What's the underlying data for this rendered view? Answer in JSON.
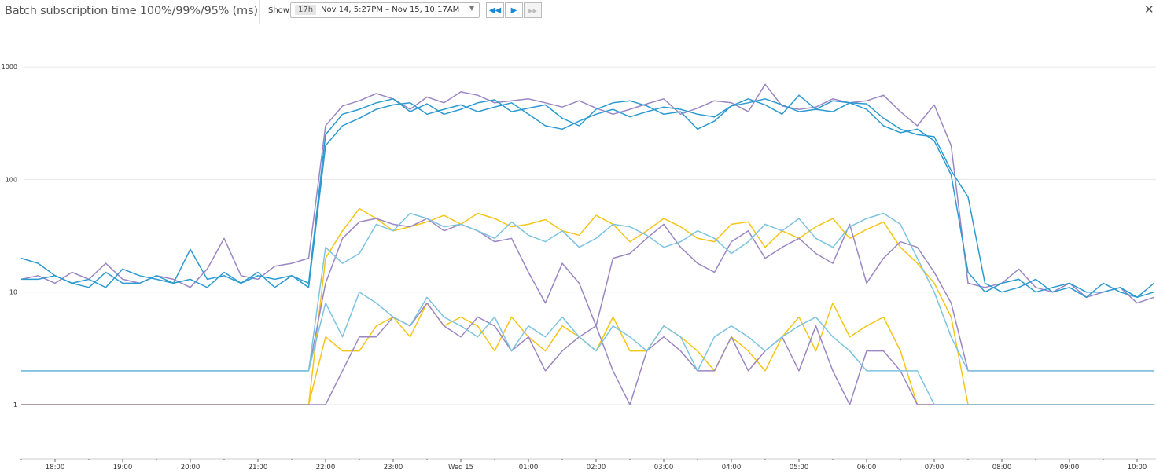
{
  "header": {
    "title": "Batch subscription time 100%/99%/95% (ms)",
    "show_label": "Show",
    "range_badge": "17h",
    "range_text": "Nov 14, 5:27PM – Nov 15, 10:17AM",
    "icons": {
      "back": "rewind-icon",
      "play": "play-icon",
      "forward": "fast-forward-icon",
      "close": "close-icon",
      "dropdown": "caret-down-icon"
    }
  },
  "chart_data": {
    "type": "line",
    "title": "Batch subscription time 100%/99%/95% (ms)",
    "xlabel": "",
    "ylabel": "",
    "y_scale": "log",
    "ylim": [
      1,
      1000
    ],
    "y_ticks": [
      "1",
      "10",
      "100",
      "1000"
    ],
    "x_ticks": [
      "18:00",
      "19:00",
      "20:00",
      "21:00",
      "22:00",
      "23:00",
      "Wed 15",
      "01:00",
      "02:00",
      "03:00",
      "04:00",
      "05:00",
      "06:00",
      "07:00",
      "08:00",
      "09:00",
      "10:00"
    ],
    "grid": true,
    "legend": "none",
    "x": [
      "17:30",
      "17:45",
      "18:00",
      "18:15",
      "18:30",
      "18:45",
      "19:00",
      "19:15",
      "19:30",
      "19:45",
      "20:00",
      "20:15",
      "20:30",
      "20:45",
      "21:00",
      "21:15",
      "21:30",
      "21:45",
      "22:00",
      "22:15",
      "22:30",
      "22:45",
      "23:00",
      "23:15",
      "23:30",
      "23:45",
      "00:00",
      "00:15",
      "00:30",
      "00:45",
      "01:00",
      "01:15",
      "01:30",
      "01:45",
      "02:00",
      "02:15",
      "02:30",
      "02:45",
      "03:00",
      "03:15",
      "03:30",
      "03:45",
      "04:00",
      "04:15",
      "04:30",
      "04:45",
      "05:00",
      "05:15",
      "05:30",
      "05:45",
      "06:00",
      "06:15",
      "06:30",
      "06:45",
      "07:00",
      "07:15",
      "07:30",
      "07:45",
      "08:00",
      "08:15",
      "08:30",
      "08:45",
      "09:00",
      "09:15",
      "09:30",
      "09:45",
      "10:00",
      "10:15"
    ],
    "series": [
      {
        "color": "#9b86c4",
        "values": [
          13,
          14,
          12,
          15,
          13,
          18,
          13,
          12,
          14,
          13,
          11,
          16,
          30,
          14,
          13,
          17,
          18,
          20,
          300,
          450,
          500,
          580,
          520,
          420,
          540,
          480,
          600,
          560,
          480,
          500,
          520,
          480,
          440,
          500,
          430,
          380,
          420,
          470,
          520,
          380,
          430,
          500,
          480,
          400,
          700,
          450,
          420,
          440,
          520,
          480,
          500,
          560,
          400,
          300,
          460,
          200,
          12,
          11,
          12,
          16,
          11,
          10,
          12,
          9,
          10,
          11,
          8,
          9
        ]
      },
      {
        "color": "#2b9ad1",
        "values": [
          20,
          18,
          14,
          12,
          13,
          11,
          16,
          14,
          13,
          12,
          24,
          13,
          14,
          12,
          15,
          11,
          14,
          12,
          250,
          380,
          420,
          480,
          520,
          400,
          470,
          380,
          420,
          480,
          510,
          400,
          430,
          460,
          350,
          300,
          420,
          480,
          500,
          450,
          380,
          400,
          280,
          330,
          450,
          520,
          460,
          380,
          560,
          420,
          400,
          480,
          470,
          350,
          280,
          250,
          240,
          120,
          70,
          12,
          10,
          11,
          13,
          10,
          11,
          9,
          12,
          10,
          9,
          12
        ]
      },
      {
        "color": "#2b9ad1",
        "values": [
          13,
          13,
          14,
          12,
          11,
          15,
          12,
          12,
          14,
          12,
          13,
          11,
          15,
          12,
          14,
          13,
          14,
          11,
          200,
          300,
          350,
          420,
          460,
          480,
          380,
          420,
          460,
          400,
          440,
          480,
          380,
          300,
          280,
          330,
          380,
          420,
          360,
          400,
          440,
          420,
          380,
          360,
          450,
          480,
          520,
          460,
          400,
          420,
          500,
          480,
          420,
          300,
          260,
          280,
          220,
          110,
          15,
          10,
          12,
          13,
          10,
          11,
          12,
          10,
          10,
          11,
          9,
          10
        ]
      },
      {
        "color": "#f5c518",
        "values": [
          1,
          1,
          1,
          1,
          1,
          1,
          1,
          1,
          1,
          1,
          1,
          1,
          1,
          1,
          1,
          1,
          1,
          1,
          20,
          35,
          55,
          45,
          35,
          38,
          42,
          48,
          40,
          50,
          45,
          38,
          40,
          44,
          35,
          32,
          48,
          40,
          28,
          35,
          45,
          38,
          30,
          28,
          40,
          42,
          25,
          35,
          30,
          38,
          45,
          30,
          36,
          42,
          25,
          18,
          12,
          6,
          1,
          1,
          1,
          1,
          1,
          1,
          1,
          1,
          1,
          1,
          1,
          1
        ]
      },
      {
        "color": "#9b86c4",
        "values": [
          2,
          2,
          2,
          2,
          2,
          2,
          2,
          2,
          2,
          2,
          2,
          2,
          2,
          2,
          2,
          2,
          2,
          2,
          12,
          30,
          42,
          45,
          40,
          38,
          45,
          35,
          40,
          35,
          28,
          30,
          15,
          8,
          18,
          12,
          5,
          20,
          22,
          30,
          40,
          25,
          18,
          15,
          28,
          35,
          20,
          25,
          30,
          22,
          18,
          40,
          12,
          20,
          28,
          25,
          15,
          8,
          2,
          2,
          2,
          2,
          2,
          2,
          2,
          2,
          2,
          2,
          2,
          2
        ]
      },
      {
        "color": "#7cc3e0",
        "values": [
          2,
          2,
          2,
          2,
          2,
          2,
          2,
          2,
          2,
          2,
          2,
          2,
          2,
          2,
          2,
          2,
          2,
          2,
          25,
          18,
          22,
          40,
          35,
          50,
          45,
          38,
          40,
          35,
          30,
          42,
          32,
          28,
          35,
          25,
          30,
          40,
          38,
          32,
          25,
          28,
          35,
          30,
          22,
          28,
          40,
          35,
          45,
          30,
          25,
          38,
          45,
          50,
          40,
          20,
          10,
          4,
          2,
          2,
          2,
          2,
          2,
          2,
          2,
          2,
          2,
          2,
          2,
          2
        ]
      },
      {
        "color": "#f5c518",
        "values": [
          1,
          1,
          1,
          1,
          1,
          1,
          1,
          1,
          1,
          1,
          1,
          1,
          1,
          1,
          1,
          1,
          1,
          1,
          4,
          3,
          3,
          5,
          6,
          4,
          8,
          5,
          6,
          5,
          3,
          6,
          4,
          3,
          5,
          4,
          3,
          6,
          3,
          3,
          5,
          4,
          3,
          2,
          4,
          3,
          2,
          4,
          6,
          3,
          8,
          4,
          5,
          6,
          3,
          1,
          1,
          1,
          1,
          1,
          1,
          1,
          1,
          1,
          1,
          1,
          1,
          1,
          1,
          1
        ]
      },
      {
        "color": "#9b86c4",
        "values": [
          1,
          1,
          1,
          1,
          1,
          1,
          1,
          1,
          1,
          1,
          1,
          1,
          1,
          1,
          1,
          1,
          1,
          1,
          1,
          2,
          4,
          4,
          6,
          5,
          8,
          5,
          4,
          6,
          5,
          3,
          4,
          2,
          3,
          4,
          5,
          2,
          1,
          3,
          4,
          3,
          2,
          2,
          4,
          2,
          3,
          4,
          2,
          5,
          2,
          1,
          3,
          3,
          2,
          1,
          1,
          1,
          1,
          1,
          1,
          1,
          1,
          1,
          1,
          1,
          1,
          1,
          1,
          1
        ]
      },
      {
        "color": "#7cc3e0",
        "values": [
          2,
          2,
          2,
          2,
          2,
          2,
          2,
          2,
          2,
          2,
          2,
          2,
          2,
          2,
          2,
          2,
          2,
          2,
          8,
          4,
          10,
          8,
          6,
          5,
          9,
          6,
          5,
          4,
          6,
          3,
          5,
          4,
          6,
          4,
          3,
          5,
          4,
          3,
          5,
          4,
          2,
          4,
          5,
          4,
          3,
          4,
          5,
          6,
          4,
          3,
          2,
          2,
          2,
          2,
          1,
          1,
          1,
          1,
          1,
          1,
          1,
          1,
          1,
          1,
          1,
          1,
          1,
          1
        ]
      }
    ]
  }
}
